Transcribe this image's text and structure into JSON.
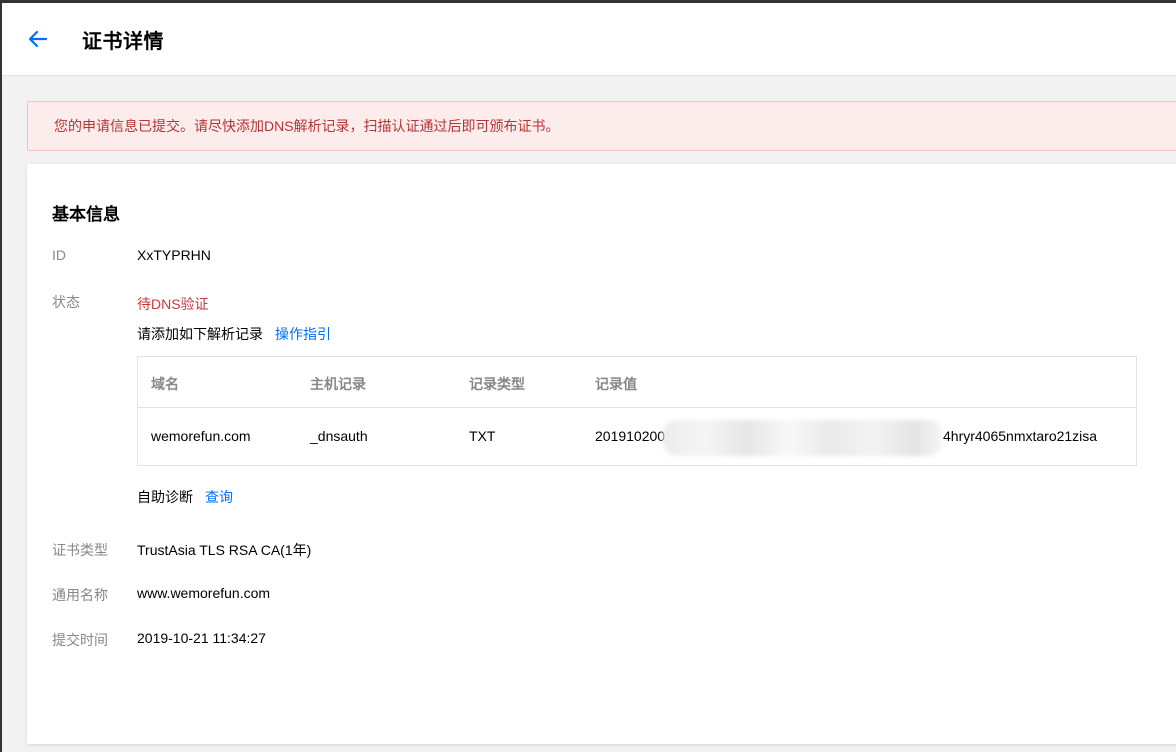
{
  "header": {
    "title": "证书详情"
  },
  "alert": {
    "message": "您的申请信息已提交。请尽快添加DNS解析记录，扫描认证通过后即可颁布证书。"
  },
  "colors": {
    "accent": "#006eff",
    "alert_text": "#b43537",
    "alert_bg": "#fcecec",
    "status": "#c43b3b"
  },
  "basic": {
    "title": "基本信息",
    "id_label": "ID",
    "id_value": "XxTYPRHN",
    "status_label": "状态",
    "status_value": "待DNS验证",
    "hint": "请添加如下解析记录",
    "guide_link": "操作指引",
    "table": {
      "headers": [
        "域名",
        "主机记录",
        "记录类型",
        "记录值"
      ],
      "rows": [
        {
          "domain": "wemorefun.com",
          "host": "_dnsauth",
          "type": "TXT",
          "value_prefix": "2019102001",
          "value_suffix": "4hryr4065nmxtaro21zisa"
        }
      ]
    },
    "diag_label": "自助诊断",
    "diag_link": "查询",
    "cert_type_label": "证书类型",
    "cert_type_value": "TrustAsia TLS RSA CA(1年)",
    "common_name_label": "通用名称",
    "common_name_value": "www.wemorefun.com",
    "submit_time_label": "提交时间",
    "submit_time_value": "2019-10-21 11:34:27"
  }
}
